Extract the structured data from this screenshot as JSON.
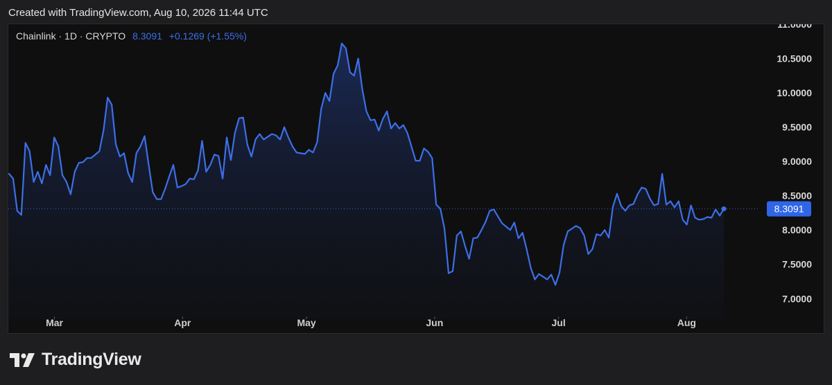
{
  "header": {
    "created_text": "Created with TradingView.com, Aug 10, 2026 11:44 UTC"
  },
  "legend": {
    "symbol": "Chainlink · 1D · CRYPTO",
    "price": "8.3091",
    "change": "+0.1269 (+1.55%)"
  },
  "branding": {
    "logo_text": "TradingView"
  },
  "colors": {
    "line": "#3d6fe8",
    "last_price_bg": "#2f66e8",
    "background": "#0f0f0f"
  },
  "chart_data": {
    "type": "area",
    "title": "",
    "xlabel": "",
    "ylabel": "",
    "x_start": "2026-02-18",
    "x_end": "2026-08-10",
    "x_ticks": [
      {
        "date": "2026-03-01",
        "label": "Mar"
      },
      {
        "date": "2026-04-01",
        "label": "Apr"
      },
      {
        "date": "2026-05-01",
        "label": "May"
      },
      {
        "date": "2026-06-01",
        "label": "Jun"
      },
      {
        "date": "2026-07-01",
        "label": "Jul"
      },
      {
        "date": "2026-08-01",
        "label": "Aug"
      }
    ],
    "y_ticks": [
      "7.0000",
      "7.5000",
      "8.0000",
      "8.5000",
      "9.0000",
      "9.5000",
      "10.0000",
      "10.5000",
      "11.0000"
    ],
    "ylim": [
      6.7,
      11.0
    ],
    "last_value": "8.3091",
    "grid": false,
    "series": [
      {
        "values": [
          8.82,
          8.75,
          8.28,
          8.22,
          9.27,
          9.15,
          8.7,
          8.85,
          8.68,
          8.95,
          8.8,
          9.35,
          9.22,
          8.8,
          8.7,
          8.52,
          8.85,
          8.98,
          8.99,
          9.05,
          9.05,
          9.1,
          9.15,
          9.45,
          9.93,
          9.83,
          9.25,
          9.07,
          9.12,
          8.83,
          8.7,
          9.12,
          9.22,
          9.37,
          8.95,
          8.55,
          8.45,
          8.45,
          8.6,
          8.78,
          8.95,
          8.62,
          8.64,
          8.67,
          8.75,
          8.74,
          8.87,
          9.3,
          8.85,
          8.95,
          9.1,
          9.08,
          8.75,
          9.35,
          9.02,
          9.42,
          9.63,
          9.64,
          9.25,
          9.07,
          9.32,
          9.4,
          9.32,
          9.36,
          9.4,
          9.38,
          9.32,
          9.5,
          9.35,
          9.22,
          9.13,
          9.12,
          9.11,
          9.17,
          9.13,
          9.28,
          9.77,
          10.0,
          9.88,
          10.28,
          10.4,
          10.72,
          10.65,
          10.3,
          10.25,
          10.5,
          10.05,
          9.73,
          9.6,
          9.61,
          9.45,
          9.62,
          9.73,
          9.48,
          9.56,
          9.48,
          9.53,
          9.41,
          9.21,
          9.01,
          9.01,
          9.19,
          9.14,
          9.05,
          8.37,
          8.31,
          8.02,
          7.37,
          7.4,
          7.92,
          7.98,
          7.77,
          7.58,
          7.88,
          7.89,
          8.0,
          8.12,
          8.28,
          8.3,
          8.2,
          8.1,
          8.05,
          8.0,
          8.11,
          7.88,
          7.96,
          7.72,
          7.45,
          7.28,
          7.36,
          7.32,
          7.28,
          7.35,
          7.2,
          7.38,
          7.78,
          7.98,
          8.02,
          8.06,
          8.03,
          7.92,
          7.65,
          7.72,
          7.94,
          7.92,
          8.0,
          7.89,
          8.34,
          8.53,
          8.35,
          8.28,
          8.36,
          8.38,
          8.52,
          8.62,
          8.6,
          8.46,
          8.36,
          8.38,
          8.82,
          8.37,
          8.42,
          8.33,
          8.42,
          8.15,
          8.08,
          8.36,
          8.18,
          8.15,
          8.16,
          8.19,
          8.18,
          8.3,
          8.21,
          8.3091
        ]
      }
    ]
  }
}
